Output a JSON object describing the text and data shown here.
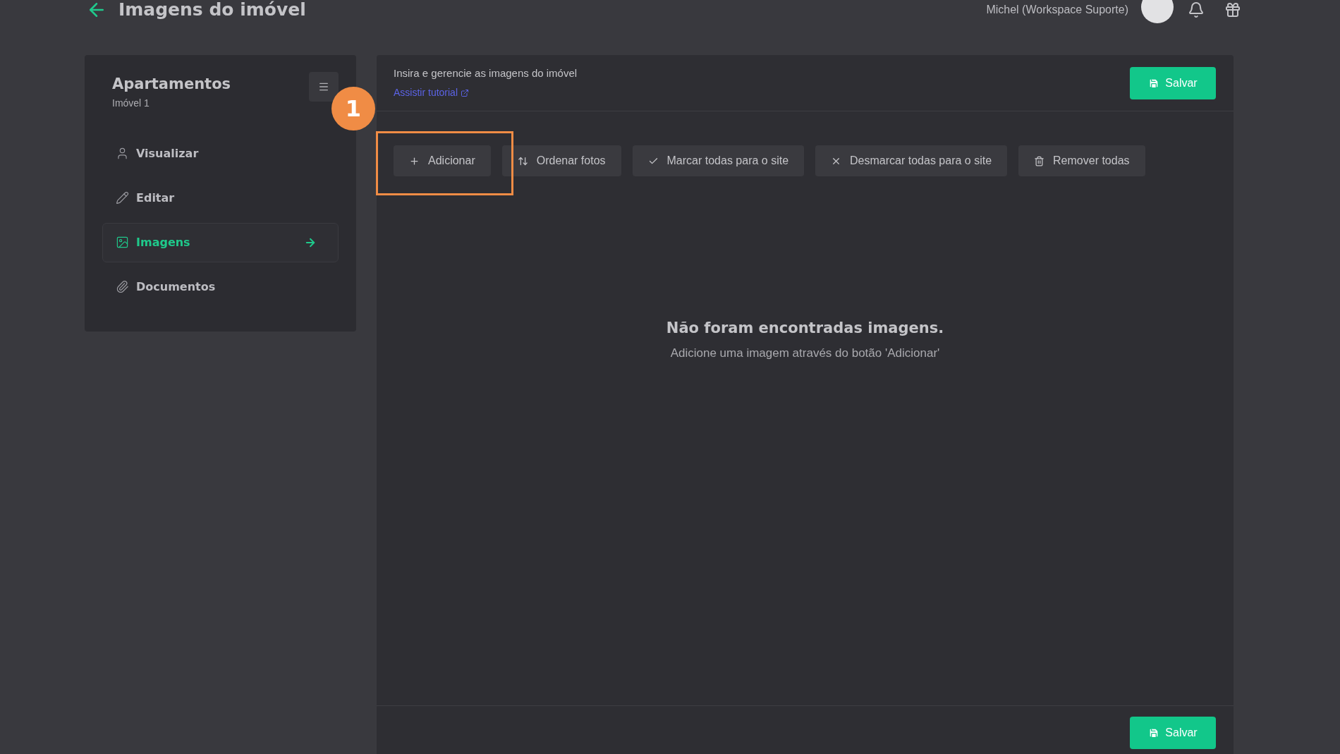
{
  "header": {
    "title": "Imagens do imóvel",
    "user_name": "Michel (Workspace Suporte)"
  },
  "sidebar": {
    "title": "Apartamentos",
    "subtitle": "Imóvel 1",
    "items": [
      {
        "label": "Visualizar",
        "selected": false
      },
      {
        "label": "Editar",
        "selected": false
      },
      {
        "label": "Imagens",
        "selected": true
      },
      {
        "label": "Documentos",
        "selected": false
      }
    ]
  },
  "main": {
    "description": "Insira e gerencie as imagens do imóvel",
    "tutorial_link": "Assistir tutorial",
    "save_button": "Salvar",
    "toolbar": [
      "Adicionar",
      "Ordenar fotos",
      "Marcar todas para o site",
      "Desmarcar todas para o site",
      "Remover todas"
    ],
    "empty_title": "Não foram encontradas imagens.",
    "empty_text": "Adicione uma imagem através do botão 'Adicionar'",
    "footer_save_button": "Salvar"
  },
  "annotation": {
    "step_number": "1"
  }
}
